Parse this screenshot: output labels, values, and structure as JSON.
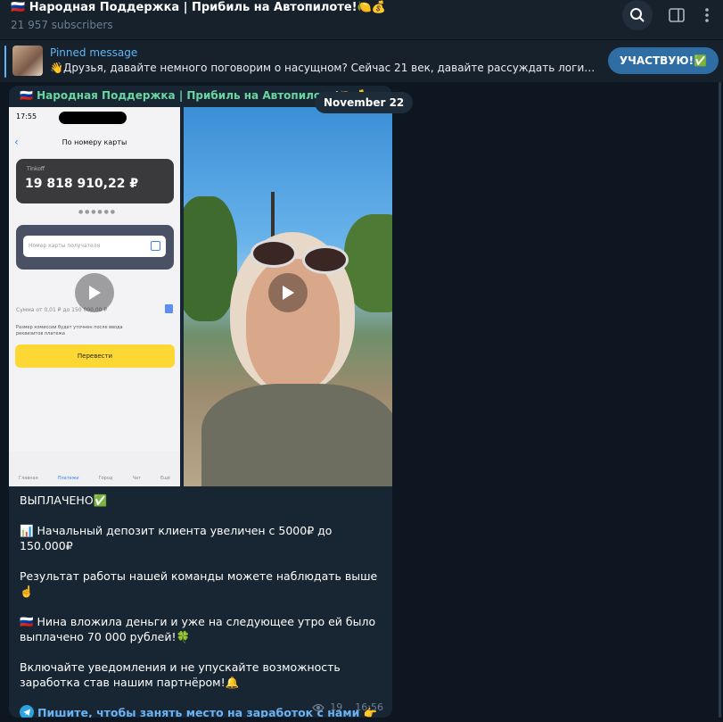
{
  "header": {
    "title": "🇷🇺 Народная Поддержка | Прибиль на Автопилоте!🍋💰",
    "subscribers": "21 957 subscribers"
  },
  "pinned": {
    "label": "Pinned message",
    "text": "👋Друзья, давайте немного поговорим о насущном? Сейчас 21 век, давайте рассуждать логиче...",
    "button": "УЧАСТВУЮ!✅"
  },
  "message": {
    "sender": "🇷🇺 Народная Поддержка | Прибиль на Автопилоте!🍋💰",
    "date": "November 22",
    "screenshot": {
      "time": "17:55",
      "title": "По номеру карты",
      "bank": "Tinkoff",
      "balance": "19 818 910,22 ₽",
      "placeholder": "Номер карты получателя",
      "sum_hint": "Сумма от 0,01 ₽ до 150 000,00 ₽",
      "fee_note": "Размер комиссии будет уточнен после ввода реквизитов платежа",
      "button": "Перевести",
      "tabs": [
        "Главная",
        "Платежи",
        "Город",
        "Чат",
        "Ещё"
      ]
    },
    "lines": [
      "ВЫПЛАЧЕНО✅",
      "📊 Начальный депозит клиента увеличен с 5000₽ до 150.000₽",
      "Результат работы нашей команды можете наблюдать выше☝️",
      "🇷🇺 Нина вложила деньги и уже на следующее утро ей было выплачено 70 000 рублей!🍀",
      "Включайте уведомления и не упускайте возможность заработка став нашим партнёром!🔔"
    ],
    "link": "Пишите, чтобы занять место на заработок с нами 👉",
    "views": "19",
    "time": "16:56"
  }
}
